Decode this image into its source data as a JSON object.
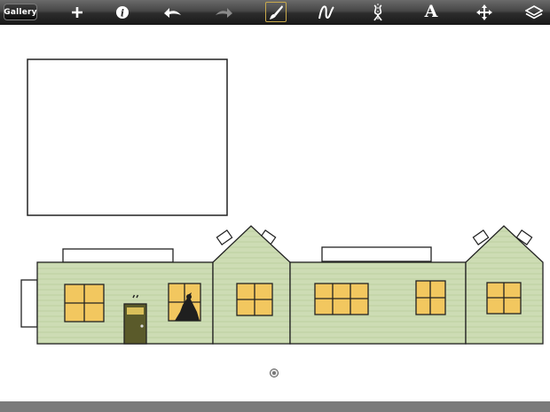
{
  "toolbar": {
    "gallery_label": "Gallery",
    "tools": [
      {
        "name": "add-icon"
      },
      {
        "name": "info-icon"
      },
      {
        "name": "undo-icon"
      },
      {
        "name": "redo-icon"
      },
      {
        "name": "brush-icon",
        "selected": true
      },
      {
        "name": "curve-icon"
      },
      {
        "name": "symmetry-icon"
      },
      {
        "name": "text-icon",
        "glyph": "A"
      },
      {
        "name": "transform-icon"
      },
      {
        "name": "layers-icon"
      }
    ]
  },
  "colors": {
    "toolbar_dark": "#1b1b1b",
    "house_fill": "#cddcb4",
    "window_fill": "#f2c75f",
    "outline": "#222222",
    "door": "#5a5a2a",
    "bottom_bar": "#7b7b7b"
  }
}
